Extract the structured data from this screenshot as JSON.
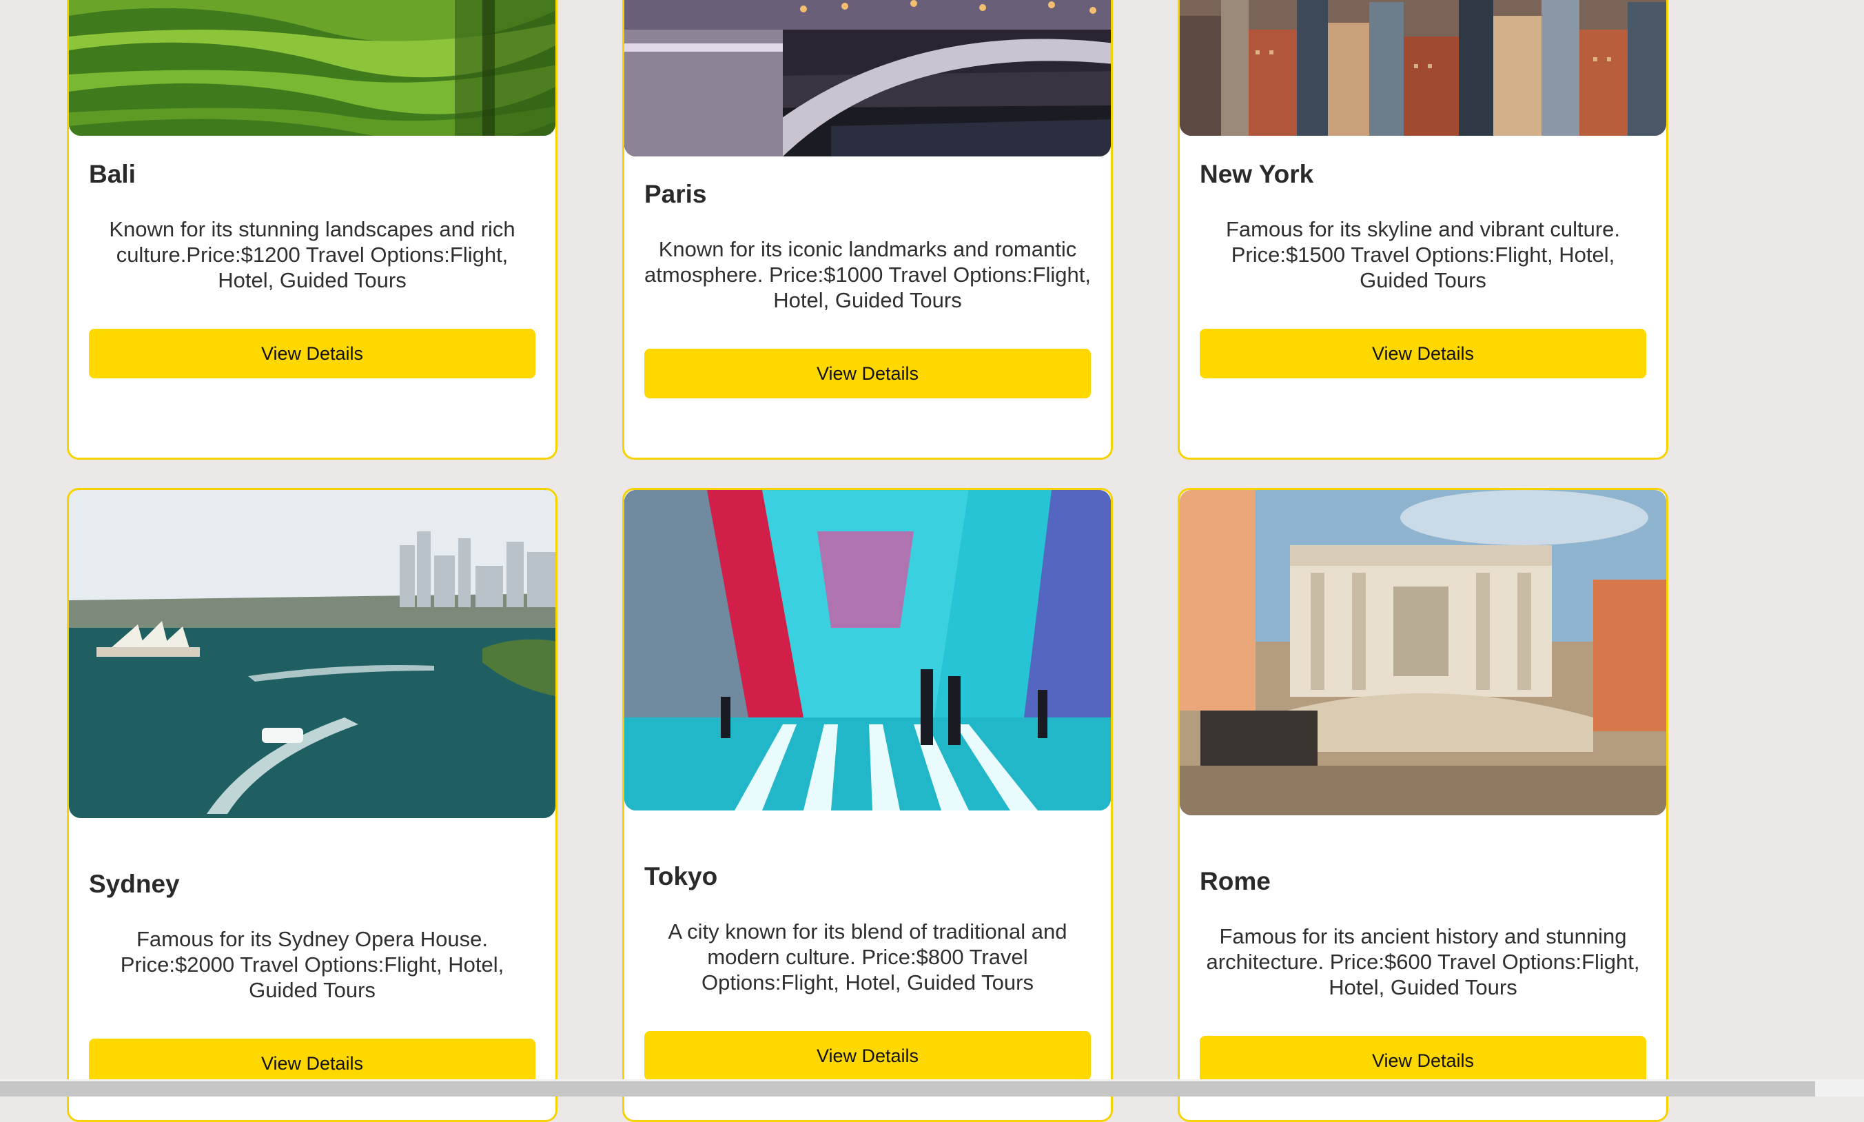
{
  "cards": [
    {
      "title": "Bali",
      "description": "Known for its stunning landscapes and rich culture.Price:$1200 Travel Options:Flight, Hotel, Guided Tours",
      "button": "View Details",
      "image": "rice-terraces-photo"
    },
    {
      "title": "Paris",
      "description": "Known for its iconic landmarks and romantic atmosphere. Price:$1000 Travel Options:Flight, Hotel, Guided Tours",
      "button": "View Details",
      "image": "seine-bridge-photo"
    },
    {
      "title": "New York",
      "description": "Famous for its skyline and vibrant culture. Price:$1500 Travel Options:Flight, Hotel, Guided Tours",
      "button": "View Details",
      "image": "city-skyline-photo"
    },
    {
      "title": "Sydney",
      "description": "Famous for its Sydney Opera House. Price:$2000 Travel Options:Flight, Hotel, Guided Tours",
      "button": "View Details",
      "image": "sydney-harbour-photo"
    },
    {
      "title": "Tokyo",
      "description": "A city known for its blend of traditional and modern culture. Price:$800 Travel Options:Flight, Hotel, Guided Tours",
      "button": "View Details",
      "image": "neon-street-photo"
    },
    {
      "title": "Rome",
      "description": "Famous for its ancient history and stunning architecture. Price:$600 Travel Options:Flight, Hotel, Guided Tours",
      "button": "View Details",
      "image": "trevi-fountain-photo"
    }
  ],
  "colors": {
    "page_background": "#ece8e8",
    "card_border": "#f5d200",
    "button_background": "#ffd800"
  }
}
